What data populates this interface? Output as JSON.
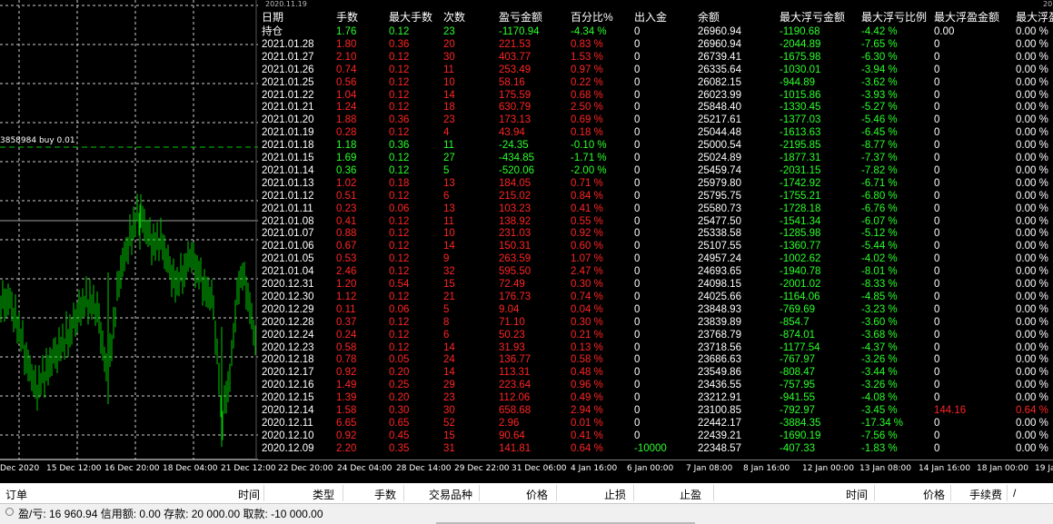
{
  "chart": {
    "top_date_left": "2020.11.19",
    "top_date_right": "20",
    "order_line_label": "3858984 buy 0.01",
    "time_axis": [
      "Dec 2020",
      "15 Dec 12:00",
      "16 Dec 20:00",
      "18 Dec 04:00",
      "21 Dec 12:00",
      "22 Dec 20:00",
      "24 Dec 04:00",
      "28 Dec 14:00",
      "29 Dec 22:00",
      "31 Dec 06:00",
      "4 Jan 16:00",
      "6 Jan 00:00",
      "7 Jan 08:00",
      "8 Jan 16:00",
      "12 Jan 00:00",
      "13 Jan 08:00",
      "14 Jan 16:00",
      "18 Jan 00:00",
      "19 Ja"
    ],
    "candle_color": "#00c800",
    "grid_color": "#d0d0d0"
  },
  "stats": {
    "headers": [
      "日期",
      "手数",
      "最大手数",
      "次数",
      "盈亏金额",
      "百分比%",
      "出入金",
      "余额",
      "最大浮亏金额",
      "最大浮亏比例",
      "最大浮盈金额",
      "最大浮盈"
    ],
    "rows": [
      {
        "c": "white",
        "v": [
          "持仓",
          "1.76",
          "0.12",
          "23",
          "-1170.94",
          "-4.34 %",
          "0",
          "26960.94",
          "-1190.68",
          "-4.42 %",
          "0.00",
          "0.00 %"
        ]
      },
      {
        "c": "red",
        "v": [
          "2021.01.28",
          "1.80",
          "0.36",
          "20",
          "221.53",
          "0.83 %",
          "0",
          "26960.94",
          "-2044.89",
          "-7.65 %",
          "0",
          "0.00 %"
        ]
      },
      {
        "c": "red",
        "v": [
          "2021.01.27",
          "2.10",
          "0.12",
          "30",
          "403.77",
          "1.53 %",
          "0",
          "26739.41",
          "-1675.98",
          "-6.30 %",
          "0",
          "0.00 %"
        ]
      },
      {
        "c": "red",
        "v": [
          "2021.01.26",
          "0.74",
          "0.12",
          "11",
          "253.49",
          "0.97 %",
          "0",
          "26335.64",
          "-1030.01",
          "-3.94 %",
          "0",
          "0.00 %"
        ]
      },
      {
        "c": "red",
        "v": [
          "2021.01.25",
          "0.56",
          "0.12",
          "10",
          "58.16",
          "0.22 %",
          "0",
          "26082.15",
          "-944.89",
          "-3.62 %",
          "0",
          "0.00 %"
        ]
      },
      {
        "c": "red",
        "v": [
          "2021.01.22",
          "1.04",
          "0.12",
          "14",
          "175.59",
          "0.68 %",
          "0",
          "26023.99",
          "-1015.86",
          "-3.93 %",
          "0",
          "0.00 %"
        ]
      },
      {
        "c": "red",
        "v": [
          "2021.01.21",
          "1.24",
          "0.12",
          "18",
          "630.79",
          "2.50 %",
          "0",
          "25848.40",
          "-1330.45",
          "-5.27 %",
          "0",
          "0.00 %"
        ]
      },
      {
        "c": "red",
        "v": [
          "2021.01.20",
          "1.88",
          "0.36",
          "23",
          "173.13",
          "0.69 %",
          "0",
          "25217.61",
          "-1377.03",
          "-5.46 %",
          "0",
          "0.00 %"
        ]
      },
      {
        "c": "red",
        "v": [
          "2021.01.19",
          "0.28",
          "0.12",
          "4",
          "43.94",
          "0.18 %",
          "0",
          "25044.48",
          "-1613.63",
          "-6.45 %",
          "0",
          "0.00 %"
        ]
      },
      {
        "c": "green",
        "v": [
          "2021.01.18",
          "1.18",
          "0.36",
          "11",
          "-24.35",
          "-0.10 %",
          "0",
          "25000.54",
          "-2195.85",
          "-8.77 %",
          "0",
          "0.00 %"
        ]
      },
      {
        "c": "green",
        "v": [
          "2021.01.15",
          "1.69",
          "0.12",
          "27",
          "-434.85",
          "-1.71 %",
          "0",
          "25024.89",
          "-1877.31",
          "-7.37 %",
          "0",
          "0.00 %"
        ]
      },
      {
        "c": "green",
        "v": [
          "2021.01.14",
          "0.36",
          "0.12",
          "5",
          "-520.06",
          "-2.00 %",
          "0",
          "25459.74",
          "-2031.15",
          "-7.82 %",
          "0",
          "0.00 %"
        ]
      },
      {
        "c": "red",
        "v": [
          "2021.01.13",
          "1.02",
          "0.18",
          "13",
          "184.05",
          "0.71 %",
          "0",
          "25979.80",
          "-1742.92",
          "-6.71 %",
          "0",
          "0.00 %"
        ]
      },
      {
        "c": "red",
        "v": [
          "2021.01.12",
          "0.51",
          "0.12",
          "6",
          "215.02",
          "0.84 %",
          "0",
          "25795.75",
          "-1755.21",
          "-6.80 %",
          "0",
          "0.00 %"
        ]
      },
      {
        "c": "red",
        "v": [
          "2021.01.11",
          "0.23",
          "0.06",
          "13",
          "103.23",
          "0.41 %",
          "0",
          "25580.73",
          "-1728.18",
          "-6.76 %",
          "0",
          "0.00 %"
        ]
      },
      {
        "c": "red",
        "v": [
          "2021.01.08",
          "0.41",
          "0.12",
          "11",
          "138.92",
          "0.55 %",
          "0",
          "25477.50",
          "-1541.34",
          "-6.07 %",
          "0",
          "0.00 %"
        ]
      },
      {
        "c": "red",
        "v": [
          "2021.01.07",
          "0.88",
          "0.12",
          "10",
          "231.03",
          "0.92 %",
          "0",
          "25338.58",
          "-1285.98",
          "-5.12 %",
          "0",
          "0.00 %"
        ]
      },
      {
        "c": "red",
        "v": [
          "2021.01.06",
          "0.67",
          "0.12",
          "14",
          "150.31",
          "0.60 %",
          "0",
          "25107.55",
          "-1360.77",
          "-5.44 %",
          "0",
          "0.00 %"
        ]
      },
      {
        "c": "red",
        "v": [
          "2021.01.05",
          "0.53",
          "0.12",
          "9",
          "263.59",
          "1.07 %",
          "0",
          "24957.24",
          "-1002.62",
          "-4.02 %",
          "0",
          "0.00 %"
        ]
      },
      {
        "c": "red",
        "v": [
          "2021.01.04",
          "2.46",
          "0.12",
          "32",
          "595.50",
          "2.47 %",
          "0",
          "24693.65",
          "-1940.78",
          "-8.01 %",
          "0",
          "0.00 %"
        ]
      },
      {
        "c": "red",
        "v": [
          "2020.12.31",
          "1.20",
          "0.54",
          "15",
          "72.49",
          "0.30 %",
          "0",
          "24098.15",
          "-2001.02",
          "-8.33 %",
          "0",
          "0.00 %"
        ]
      },
      {
        "c": "red",
        "v": [
          "2020.12.30",
          "1.12",
          "0.12",
          "21",
          "176.73",
          "0.74 %",
          "0",
          "24025.66",
          "-1164.06",
          "-4.85 %",
          "0",
          "0.00 %"
        ]
      },
      {
        "c": "red",
        "v": [
          "2020.12.29",
          "0.11",
          "0.06",
          "5",
          "9.04",
          "0.04 %",
          "0",
          "23848.93",
          "-769.69",
          "-3.23 %",
          "0",
          "0.00 %"
        ]
      },
      {
        "c": "red",
        "v": [
          "2020.12.28",
          "0.37",
          "0.12",
          "8",
          "71.10",
          "0.30 %",
          "0",
          "23839.89",
          "-854.7",
          "-3.60 %",
          "0",
          "0.00 %"
        ]
      },
      {
        "c": "red",
        "v": [
          "2020.12.24",
          "0.24",
          "0.12",
          "6",
          "50.23",
          "0.21 %",
          "0",
          "23768.79",
          "-874.01",
          "-3.68 %",
          "0",
          "0.00 %"
        ]
      },
      {
        "c": "red",
        "v": [
          "2020.12.23",
          "0.58",
          "0.12",
          "14",
          "31.93",
          "0.13 %",
          "0",
          "23718.56",
          "-1177.54",
          "-4.37 %",
          "0",
          "0.00 %"
        ]
      },
      {
        "c": "red",
        "v": [
          "2020.12.18",
          "0.78",
          "0.05",
          "24",
          "136.77",
          "0.58 %",
          "0",
          "23686.63",
          "-767.97",
          "-3.26 %",
          "0",
          "0.00 %"
        ]
      },
      {
        "c": "red",
        "v": [
          "2020.12.17",
          "0.92",
          "0.20",
          "14",
          "113.31",
          "0.48 %",
          "0",
          "23549.86",
          "-808.47",
          "-3.44 %",
          "0",
          "0.00 %"
        ]
      },
      {
        "c": "red",
        "v": [
          "2020.12.16",
          "1.49",
          "0.25",
          "29",
          "223.64",
          "0.96 %",
          "0",
          "23436.55",
          "-757.95",
          "-3.26 %",
          "0",
          "0.00 %"
        ]
      },
      {
        "c": "red",
        "v": [
          "2020.12.15",
          "1.39",
          "0.20",
          "23",
          "112.06",
          "0.49 %",
          "0",
          "23212.91",
          "-941.55",
          "-4.08 %",
          "0",
          "0.00 %"
        ]
      },
      {
        "c": "red",
        "v": [
          "2020.12.14",
          "1.58",
          "0.30",
          "30",
          "658.68",
          "2.94 %",
          "0",
          "23100.85",
          "-792.97",
          "-3.45 %",
          "144.16",
          "0.64 %"
        ]
      },
      {
        "c": "red",
        "v": [
          "2020.12.11",
          "6.65",
          "0.65",
          "52",
          "2.96",
          "0.01 %",
          "0",
          "22442.17",
          "-3884.35",
          "-17.34 %",
          "0",
          "0.00 %"
        ]
      },
      {
        "c": "red",
        "v": [
          "2020.12.10",
          "0.92",
          "0.45",
          "15",
          "90.64",
          "0.41 %",
          "0",
          "22439.21",
          "-1690.19",
          "-7.56 %",
          "0",
          "0.00 %"
        ]
      },
      {
        "c": "red",
        "v": [
          "2020.12.09",
          "2.20",
          "0.35",
          "31",
          "141.81",
          "0.64 %",
          "-10000",
          "22348.57",
          "-407.33",
          "-1.83 %",
          "0",
          "0.00 %"
        ]
      }
    ]
  },
  "terminal": {
    "headers": [
      "订单",
      "时间",
      "类型",
      "手数",
      "交易品种",
      "价格",
      "止损",
      "止盈",
      "时间",
      "价格",
      "手续费",
      "/"
    ],
    "summary": "盈/亏: 16 960.94  信用额: 0.00  存款: 20 000.00  取款: -10 000.00"
  }
}
